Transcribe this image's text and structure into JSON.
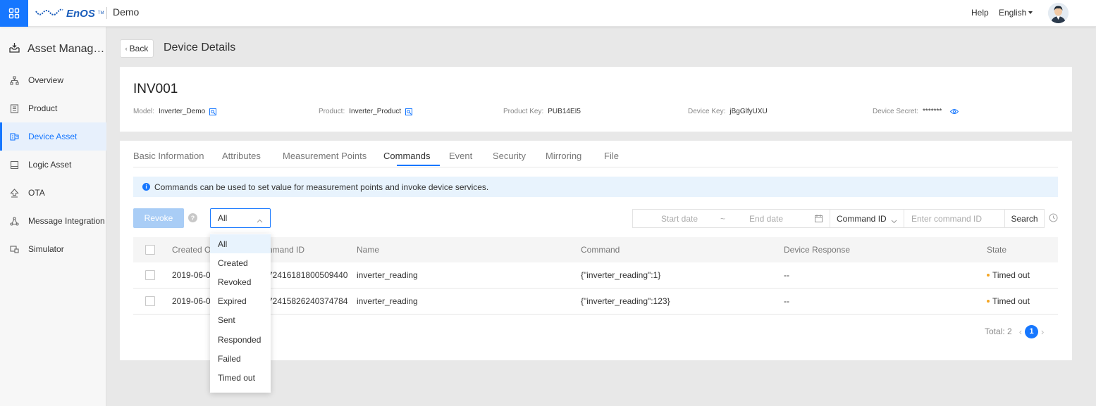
{
  "topbar": {
    "logo_text": "EnOS",
    "org_name": "Demo",
    "help": "Help",
    "language": "English"
  },
  "sidebar": {
    "title": "Asset Manag…",
    "items": [
      {
        "label": "Overview",
        "icon": "org-chart-icon"
      },
      {
        "label": "Product",
        "icon": "product-icon"
      },
      {
        "label": "Device Asset",
        "icon": "device-asset-icon",
        "active": true
      },
      {
        "label": "Logic Asset",
        "icon": "logic-asset-icon"
      },
      {
        "label": "OTA",
        "icon": "upload-icon"
      },
      {
        "label": "Message Integration",
        "icon": "integration-icon"
      },
      {
        "label": "Simulator",
        "icon": "simulator-icon"
      }
    ]
  },
  "header": {
    "back_label": "Back",
    "title": "Device Details"
  },
  "device": {
    "name": "INV001",
    "model_label": "Model:",
    "model_value": "Inverter_Demo",
    "product_label": "Product:",
    "product_value": "Inverter_Product",
    "product_key_label": "Product Key:",
    "product_key_value": "PUB14EI5",
    "device_key_label": "Device Key:",
    "device_key_value": "jBgGlfyUXU",
    "device_secret_label": "Device Secret:",
    "device_secret_value": "*******"
  },
  "tabs": [
    "Basic Information",
    "Attributes",
    "Measurement Points",
    "Commands",
    "Event",
    "Security",
    "Mirroring",
    "File"
  ],
  "active_tab": "Commands",
  "info_message": "Commands can be used to set value for measurement points and invoke device services.",
  "toolbar": {
    "revoke_label": "Revoke",
    "state_filter_value": "All",
    "start_date_placeholder": "Start date",
    "range_separator": "~",
    "end_date_placeholder": "End date",
    "search_field": "Command ID",
    "search_placeholder": "Enter command ID",
    "search_label": "Search"
  },
  "table": {
    "columns": [
      "Created O",
      "nmand ID",
      "Name",
      "Command",
      "Device Response",
      "State"
    ],
    "rows": [
      {
        "created": "2019-06-0",
        "command_id": "72416181800509440",
        "name": "inverter_reading",
        "command": "{\"inverter_reading\":1}",
        "response": "--",
        "state": "Timed out"
      },
      {
        "created": "2019-06-0",
        "command_id": "72415826240374784",
        "name": "inverter_reading",
        "command": "{\"inverter_reading\":123}",
        "response": "--",
        "state": "Timed out"
      }
    ]
  },
  "pagination": {
    "total_label": "Total: 2",
    "current_page": "1"
  },
  "dropdown_options": [
    "All",
    "Created",
    "Revoked",
    "Expired",
    "Sent",
    "Responded",
    "Failed",
    "Timed out"
  ],
  "colors": {
    "accent": "#1677ff",
    "state_timed_out": "#f5a623",
    "info_bg": "#e8f3fd"
  }
}
